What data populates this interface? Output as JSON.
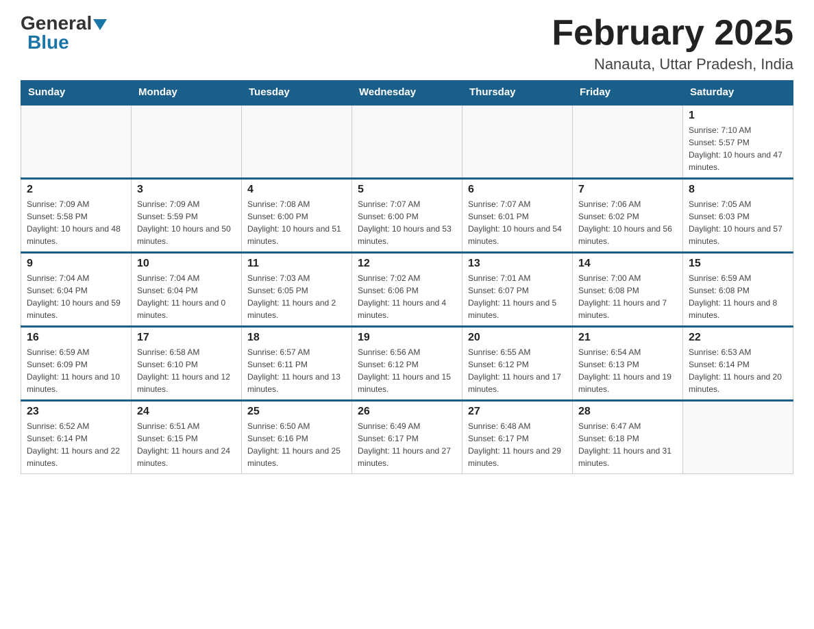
{
  "logo": {
    "general": "General",
    "blue": "Blue"
  },
  "title": "February 2025",
  "subtitle": "Nanauta, Uttar Pradesh, India",
  "days_of_week": [
    "Sunday",
    "Monday",
    "Tuesday",
    "Wednesday",
    "Thursday",
    "Friday",
    "Saturday"
  ],
  "weeks": [
    [
      {
        "day": "",
        "info": ""
      },
      {
        "day": "",
        "info": ""
      },
      {
        "day": "",
        "info": ""
      },
      {
        "day": "",
        "info": ""
      },
      {
        "day": "",
        "info": ""
      },
      {
        "day": "",
        "info": ""
      },
      {
        "day": "1",
        "info": "Sunrise: 7:10 AM\nSunset: 5:57 PM\nDaylight: 10 hours and 47 minutes."
      }
    ],
    [
      {
        "day": "2",
        "info": "Sunrise: 7:09 AM\nSunset: 5:58 PM\nDaylight: 10 hours and 48 minutes."
      },
      {
        "day": "3",
        "info": "Sunrise: 7:09 AM\nSunset: 5:59 PM\nDaylight: 10 hours and 50 minutes."
      },
      {
        "day": "4",
        "info": "Sunrise: 7:08 AM\nSunset: 6:00 PM\nDaylight: 10 hours and 51 minutes."
      },
      {
        "day": "5",
        "info": "Sunrise: 7:07 AM\nSunset: 6:00 PM\nDaylight: 10 hours and 53 minutes."
      },
      {
        "day": "6",
        "info": "Sunrise: 7:07 AM\nSunset: 6:01 PM\nDaylight: 10 hours and 54 minutes."
      },
      {
        "day": "7",
        "info": "Sunrise: 7:06 AM\nSunset: 6:02 PM\nDaylight: 10 hours and 56 minutes."
      },
      {
        "day": "8",
        "info": "Sunrise: 7:05 AM\nSunset: 6:03 PM\nDaylight: 10 hours and 57 minutes."
      }
    ],
    [
      {
        "day": "9",
        "info": "Sunrise: 7:04 AM\nSunset: 6:04 PM\nDaylight: 10 hours and 59 minutes."
      },
      {
        "day": "10",
        "info": "Sunrise: 7:04 AM\nSunset: 6:04 PM\nDaylight: 11 hours and 0 minutes."
      },
      {
        "day": "11",
        "info": "Sunrise: 7:03 AM\nSunset: 6:05 PM\nDaylight: 11 hours and 2 minutes."
      },
      {
        "day": "12",
        "info": "Sunrise: 7:02 AM\nSunset: 6:06 PM\nDaylight: 11 hours and 4 minutes."
      },
      {
        "day": "13",
        "info": "Sunrise: 7:01 AM\nSunset: 6:07 PM\nDaylight: 11 hours and 5 minutes."
      },
      {
        "day": "14",
        "info": "Sunrise: 7:00 AM\nSunset: 6:08 PM\nDaylight: 11 hours and 7 minutes."
      },
      {
        "day": "15",
        "info": "Sunrise: 6:59 AM\nSunset: 6:08 PM\nDaylight: 11 hours and 8 minutes."
      }
    ],
    [
      {
        "day": "16",
        "info": "Sunrise: 6:59 AM\nSunset: 6:09 PM\nDaylight: 11 hours and 10 minutes."
      },
      {
        "day": "17",
        "info": "Sunrise: 6:58 AM\nSunset: 6:10 PM\nDaylight: 11 hours and 12 minutes."
      },
      {
        "day": "18",
        "info": "Sunrise: 6:57 AM\nSunset: 6:11 PM\nDaylight: 11 hours and 13 minutes."
      },
      {
        "day": "19",
        "info": "Sunrise: 6:56 AM\nSunset: 6:12 PM\nDaylight: 11 hours and 15 minutes."
      },
      {
        "day": "20",
        "info": "Sunrise: 6:55 AM\nSunset: 6:12 PM\nDaylight: 11 hours and 17 minutes."
      },
      {
        "day": "21",
        "info": "Sunrise: 6:54 AM\nSunset: 6:13 PM\nDaylight: 11 hours and 19 minutes."
      },
      {
        "day": "22",
        "info": "Sunrise: 6:53 AM\nSunset: 6:14 PM\nDaylight: 11 hours and 20 minutes."
      }
    ],
    [
      {
        "day": "23",
        "info": "Sunrise: 6:52 AM\nSunset: 6:14 PM\nDaylight: 11 hours and 22 minutes."
      },
      {
        "day": "24",
        "info": "Sunrise: 6:51 AM\nSunset: 6:15 PM\nDaylight: 11 hours and 24 minutes."
      },
      {
        "day": "25",
        "info": "Sunrise: 6:50 AM\nSunset: 6:16 PM\nDaylight: 11 hours and 25 minutes."
      },
      {
        "day": "26",
        "info": "Sunrise: 6:49 AM\nSunset: 6:17 PM\nDaylight: 11 hours and 27 minutes."
      },
      {
        "day": "27",
        "info": "Sunrise: 6:48 AM\nSunset: 6:17 PM\nDaylight: 11 hours and 29 minutes."
      },
      {
        "day": "28",
        "info": "Sunrise: 6:47 AM\nSunset: 6:18 PM\nDaylight: 11 hours and 31 minutes."
      },
      {
        "day": "",
        "info": ""
      }
    ]
  ]
}
